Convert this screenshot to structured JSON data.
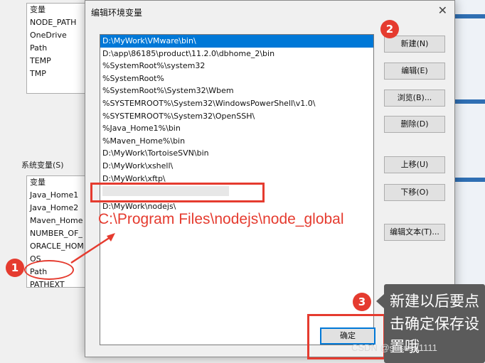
{
  "user_vars": {
    "header": "变量",
    "items": [
      "NODE_PATH",
      "OneDrive",
      "Path",
      "TEMP",
      "TMP"
    ]
  },
  "system_vars": {
    "section_label": "系统变量(S)",
    "header": "变量",
    "items": [
      "Java_Home1",
      "Java_Home2",
      "Maven_Home",
      "NUMBER_OF_",
      "ORACLE_HOM",
      "OS",
      "Path",
      "PATHEXT"
    ]
  },
  "dialog": {
    "title": "编辑环境变量",
    "close_glyph": "✕",
    "paths": [
      "D:\\MyWork\\VMware\\bin\\",
      "D:\\app\\86185\\product\\11.2.0\\dbhome_2\\bin",
      "%SystemRoot%\\system32",
      "%SystemRoot%",
      "%SystemRoot%\\System32\\Wbem",
      "%SYSTEMROOT%\\System32\\WindowsPowerShell\\v1.0\\",
      "%SYSTEMROOT%\\System32\\OpenSSH\\",
      "%Java_Home1%\\bin",
      "%Maven_Home%\\bin",
      "D:\\MyWork\\TortoiseSVN\\bin",
      "D:\\MyWork\\xshell\\",
      "D:\\MyWork\\xftp\\",
      "",
      "D:\\MyWork\\nodejs\\"
    ],
    "buttons": {
      "new": "新建(N)",
      "edit": "编辑(E)",
      "browse": "浏览(B)...",
      "delete": "删除(D)",
      "move_up": "上移(U)",
      "move_down": "下移(O)",
      "edit_text": "编辑文本(T)...",
      "ok": "确定"
    }
  },
  "annotations": {
    "badge1": "1",
    "badge2": "2",
    "badge3": "3",
    "new_path": "C:\\Program Files\\nodejs\\node_global",
    "tooltip": "新建以后要点击确定保存设置哦",
    "watermark": "CSDN @sususu1111",
    "color": "#e53b2f"
  }
}
